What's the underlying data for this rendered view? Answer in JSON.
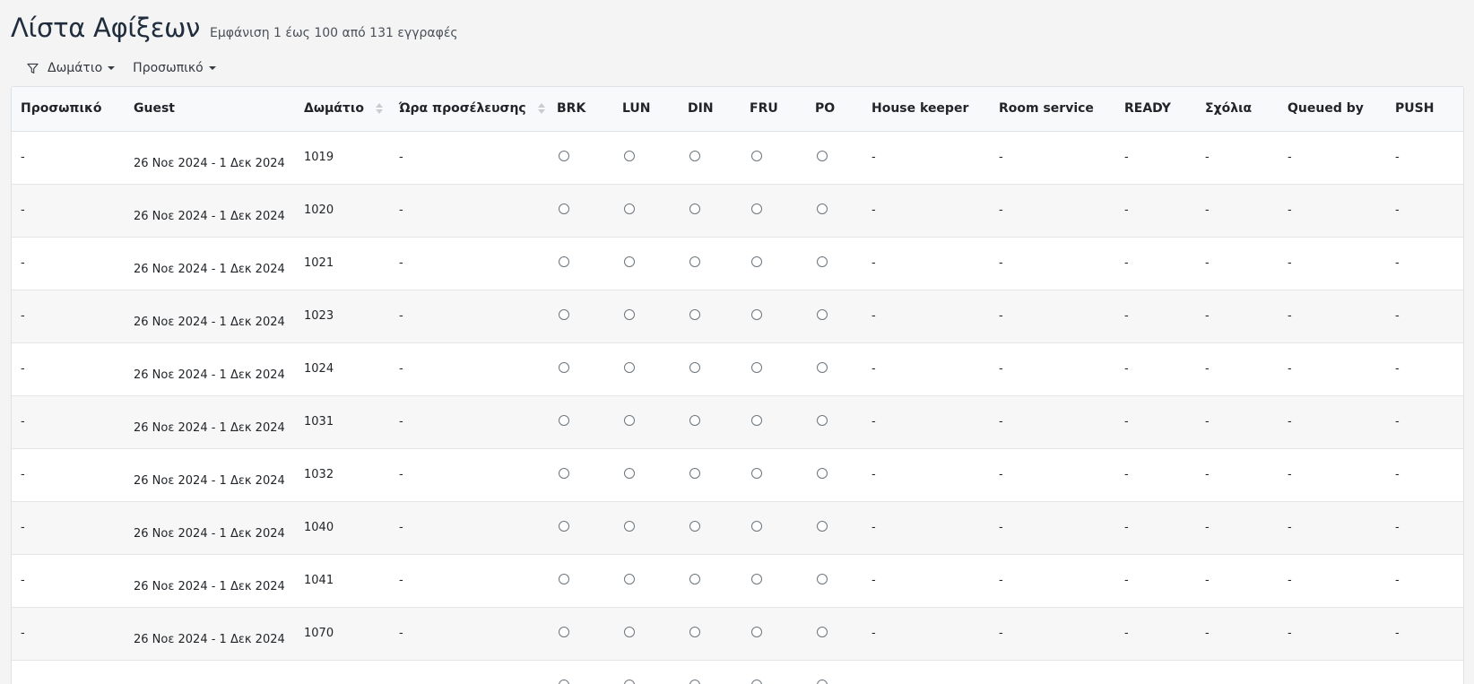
{
  "header": {
    "title": "Λίστα Αφίξεων",
    "record_count": "Εμφάνιση 1 έως 100 από 131 εγγραφές"
  },
  "filters": {
    "room_label": "Δωμάτιο",
    "staff_label": "Προσωπικό"
  },
  "table": {
    "columns": [
      "Προσωπικό",
      "Guest",
      "Δωμάτιο",
      "Ώρα προσέλευσης",
      "BRK",
      "LUN",
      "DIN",
      "FRU",
      "PO",
      "House keeper",
      "Room service",
      "READY",
      "Σχόλια",
      "Queued by",
      "PUSH"
    ],
    "rows": [
      {
        "staff": "-",
        "guest": "26 Νοε 2024 - 1 Δεκ 2024",
        "room": "1019",
        "arrival": "-",
        "housekeeper": "-",
        "room_service": "-",
        "ready": "-",
        "comments": "-",
        "queued_by": "-",
        "push": "-"
      },
      {
        "staff": "-",
        "guest": "26 Νοε 2024 - 1 Δεκ 2024",
        "room": "1020",
        "arrival": "-",
        "housekeeper": "-",
        "room_service": "-",
        "ready": "-",
        "comments": "-",
        "queued_by": "-",
        "push": "-"
      },
      {
        "staff": "-",
        "guest": "26 Νοε 2024 - 1 Δεκ 2024",
        "room": "1021",
        "arrival": "-",
        "housekeeper": "-",
        "room_service": "-",
        "ready": "-",
        "comments": "-",
        "queued_by": "-",
        "push": "-"
      },
      {
        "staff": "-",
        "guest": "26 Νοε 2024 - 1 Δεκ 2024",
        "room": "1023",
        "arrival": "-",
        "housekeeper": "-",
        "room_service": "-",
        "ready": "-",
        "comments": "-",
        "queued_by": "-",
        "push": "-"
      },
      {
        "staff": "-",
        "guest": "26 Νοε 2024 - 1 Δεκ 2024",
        "room": "1024",
        "arrival": "-",
        "housekeeper": "-",
        "room_service": "-",
        "ready": "-",
        "comments": "-",
        "queued_by": "-",
        "push": "-"
      },
      {
        "staff": "-",
        "guest": "26 Νοε 2024 - 1 Δεκ 2024",
        "room": "1031",
        "arrival": "-",
        "housekeeper": "-",
        "room_service": "-",
        "ready": "-",
        "comments": "-",
        "queued_by": "-",
        "push": "-"
      },
      {
        "staff": "-",
        "guest": "26 Νοε 2024 - 1 Δεκ 2024",
        "room": "1032",
        "arrival": "-",
        "housekeeper": "-",
        "room_service": "-",
        "ready": "-",
        "comments": "-",
        "queued_by": "-",
        "push": "-"
      },
      {
        "staff": "-",
        "guest": "26 Νοε 2024 - 1 Δεκ 2024",
        "room": "1040",
        "arrival": "-",
        "housekeeper": "-",
        "room_service": "-",
        "ready": "-",
        "comments": "-",
        "queued_by": "-",
        "push": "-"
      },
      {
        "staff": "-",
        "guest": "26 Νοε 2024 - 1 Δεκ 2024",
        "room": "1041",
        "arrival": "-",
        "housekeeper": "-",
        "room_service": "-",
        "ready": "-",
        "comments": "-",
        "queued_by": "-",
        "push": "-"
      },
      {
        "staff": "-",
        "guest": "26 Νοε 2024 - 1 Δεκ 2024",
        "room": "1070",
        "arrival": "-",
        "housekeeper": "-",
        "room_service": "-",
        "ready": "-",
        "comments": "-",
        "queued_by": "-",
        "push": "-"
      }
    ]
  },
  "icons": {
    "filter": "funnel-icon",
    "dropdown": "caret-down-icon",
    "sort": "sort-icon",
    "meal_toggle": "radio-icon"
  }
}
